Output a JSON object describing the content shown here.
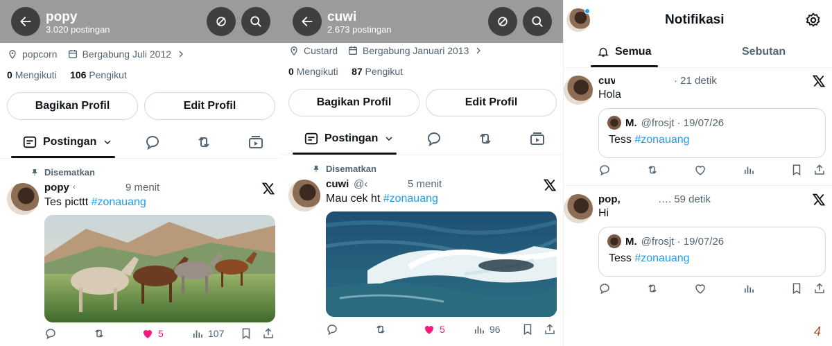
{
  "panels": [
    {
      "name": "popy",
      "posts": "3.020 postingan",
      "location": "popcorn",
      "joined": "Bergabung Juli 2012",
      "following_count": "0",
      "following_label": "Mengikuti",
      "followers_count": "106",
      "followers_label": "Pengikut",
      "share_label": "Bagikan Profil",
      "edit_label": "Edit Profil",
      "tab_posts": "Postingan",
      "pinned": "Disematkan",
      "post": {
        "author": "popy",
        "handle": "‹",
        "time": "9 menit",
        "text": "Tes picttt ",
        "hashtag": "#zonauang",
        "image": "horses-running",
        "likes": "5",
        "views": "107"
      }
    },
    {
      "name": "cuwi",
      "posts": "2.673 postingan",
      "location": "Custard",
      "joined": "Bergabung Januari 2013",
      "following_count": "0",
      "following_label": "Mengikuti",
      "followers_count": "87",
      "followers_label": "Pengikut",
      "share_label": "Bagikan Profil",
      "edit_label": "Edit Profil",
      "tab_posts": "Postingan",
      "pinned": "Disematkan",
      "post": {
        "author": "cuwi",
        "handle": "@‹",
        "time": "5 menit",
        "text": "Mau cek ht ",
        "hashtag": "#zonauang",
        "image": "ocean-waves",
        "likes": "5",
        "views": "96"
      }
    }
  ],
  "notifications": {
    "title": "Notifikasi",
    "tab_all": "Semua",
    "tab_mentions": "Sebutan",
    "items": [
      {
        "author": "cuv",
        "time": "· 21 detik",
        "text": "Hola",
        "quote_author": "M.",
        "quote_meta": "@frosjt · 19/07/26",
        "quote_text": "Tess ",
        "quote_tag": "#zonauang"
      },
      {
        "author": "pop,",
        "time": "…. 59 detik",
        "text": "Hi",
        "quote_author": "M.",
        "quote_meta": "@frosjt · 19/07/26",
        "quote_text": "Tess ",
        "quote_tag": "#zonauang"
      }
    ]
  },
  "corner_mark": "4",
  "colors": {
    "header_gray": "#9b9b9b",
    "circle_button": "#3f3f3f",
    "link_blue": "#1d9bf0",
    "like_pink": "#f91880",
    "muted": "#536471"
  }
}
